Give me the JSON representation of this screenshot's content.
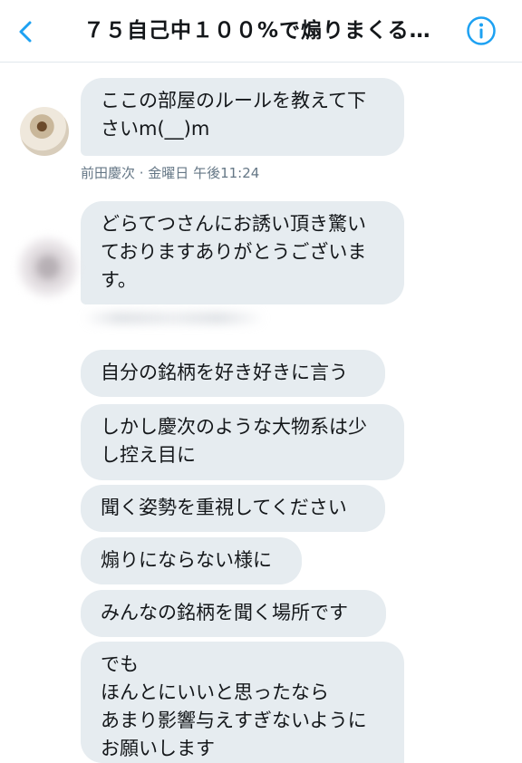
{
  "header": {
    "title": "７５自己中１００%で煽りまくる…",
    "back_icon": "chevron-left-icon",
    "info_icon": "info-circle-icon",
    "accent_color": "#1da1f2"
  },
  "messages": [
    {
      "text": "ここの部屋のルールを教えて下さいm(__)m"
    },
    {
      "text": "どらてつさんにお誘い頂き驚いておりますありがとうございます。"
    },
    {
      "text": "自分の銘柄を好き好きに言う"
    },
    {
      "text": "しかし慶次のような大物系は少し控え目に"
    },
    {
      "text": "聞く姿勢を重視してください"
    },
    {
      "text": "煽りにならない様に"
    },
    {
      "text": "みんなの銘柄を聞く場所です"
    },
    {
      "text": "でも\nほんとにいいと思ったなら\nあまり影響与えすぎないように\nお願いします"
    }
  ],
  "meta": {
    "sender_timestamp": "前田慶次 · 金曜日 午後11:24"
  }
}
